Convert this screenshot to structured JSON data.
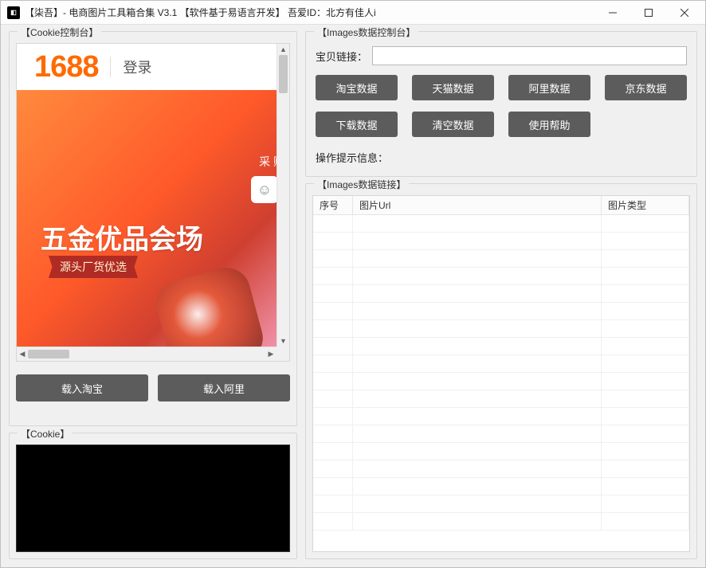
{
  "window": {
    "title": "【柒吾】- 电商图片工具箱合集 V3.1  【软件基于易语言开发】 吾爱ID：北方有佳人i"
  },
  "cookie_console": {
    "legend": "【Cookie控制台】",
    "logo": "1688",
    "login_label": "登录",
    "banner_title": "五金优品会场",
    "banner_ribbon": "源头厂货优选",
    "banner_side": "采 购",
    "load_taobao": "载入淘宝",
    "load_ali": "载入阿里"
  },
  "cookie_text": {
    "legend": "【Cookie】",
    "value": ""
  },
  "images_console": {
    "legend": "【Images数据控制台】",
    "link_label": "宝贝链接：",
    "link_value": "",
    "btn_taobao": "淘宝数据",
    "btn_tmall": "天猫数据",
    "btn_ali": "阿里数据",
    "btn_jd": "京东数据",
    "btn_download": "下载数据",
    "btn_clear": "清空数据",
    "btn_help": "使用帮助",
    "hint": "操作提示信息："
  },
  "images_links": {
    "legend": "【Images数据链接】",
    "col_idx": "序号",
    "col_url": "图片Url",
    "col_type": "图片类型",
    "rows": []
  }
}
